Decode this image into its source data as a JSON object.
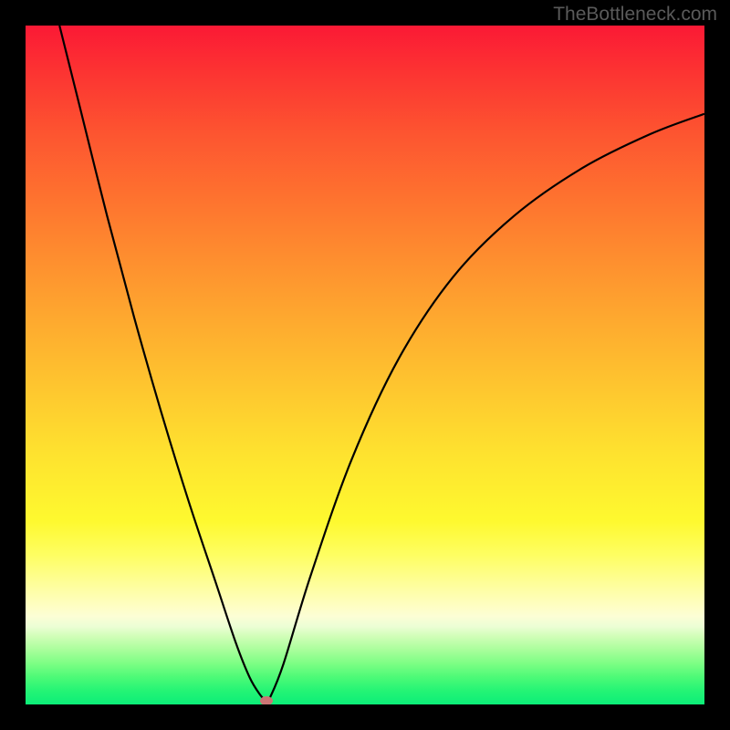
{
  "watermark": "TheBottleneck.com",
  "chart_data": {
    "type": "line",
    "title": "",
    "xlabel": "",
    "ylabel": "",
    "xlim": [
      0,
      100
    ],
    "ylim": [
      0,
      100
    ],
    "grid": false,
    "legend": false,
    "background": "rainbow-gradient-vertical",
    "series": [
      {
        "name": "bottleneck-curve",
        "color": "#000000",
        "x": [
          5,
          8,
          12,
          16,
          20,
          24,
          28,
          31,
          33,
          34.5,
          35.5,
          36,
          38,
          42,
          48,
          55,
          63,
          72,
          82,
          92,
          100
        ],
        "y": [
          100,
          88,
          72,
          57,
          43,
          30,
          18,
          9,
          4,
          1.5,
          0.5,
          1,
          6,
          19,
          36,
          51,
          63,
          72,
          79,
          84,
          87
        ]
      }
    ],
    "marker": {
      "x": 35.5,
      "y": 0.5,
      "color": "#cc7575"
    },
    "gradient_stops": [
      {
        "pos": 0,
        "color": "#fb1935"
      },
      {
        "pos": 25,
        "color": "#fe712f"
      },
      {
        "pos": 54,
        "color": "#fec82f"
      },
      {
        "pos": 73,
        "color": "#fef92f"
      },
      {
        "pos": 87,
        "color": "#fcfed5"
      },
      {
        "pos": 100,
        "color": "#0cee78"
      }
    ]
  }
}
